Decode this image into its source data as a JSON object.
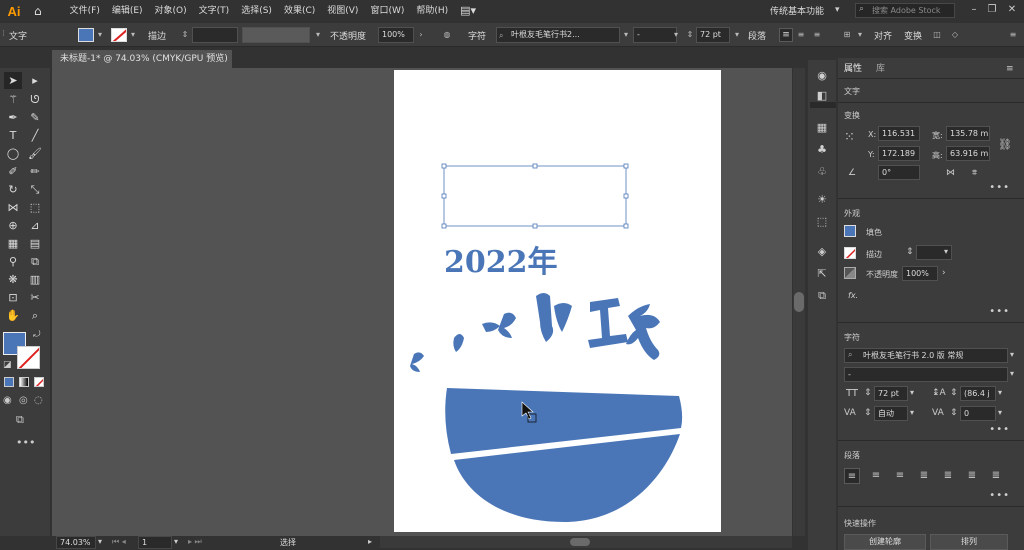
{
  "app": {
    "logo": "Ai"
  },
  "menu": [
    "文件(F)",
    "编辑(E)",
    "对象(O)",
    "文字(T)",
    "选择(S)",
    "效果(C)",
    "视图(V)",
    "窗口(W)",
    "帮助(H)"
  ],
  "workspace": "传统基本功能",
  "stock_search": {
    "placeholder": "搜索 Adobe Stock"
  },
  "control_bar": {
    "type_label": "文字",
    "stroke_label": "描边",
    "opacity_label": "不透明度",
    "opacity_value": "100%",
    "char_label": "字符",
    "font_value": "叶根友毛笔行书2...",
    "style_value": "-",
    "size_value": "72 pt",
    "para_label": "段落",
    "align_label": "对齐",
    "transform_label": "变换",
    "fill_color": "#4a76b8"
  },
  "document_tab": {
    "title": "未标题-1* @ 74.03% (CMYK/GPU 预览)",
    "close": "×"
  },
  "artwork": {
    "year_text": "2022年",
    "title_text": "美人迷鹿工号",
    "color": "#4a76b8"
  },
  "status_bar": {
    "zoom": "74.03%",
    "artboard": "1",
    "tool": "选择"
  },
  "properties_panel": {
    "tabs": [
      "属性",
      "库"
    ],
    "object_type": "文字",
    "transform": {
      "title": "变换",
      "x_label": "X:",
      "x": "116.531",
      "y_label": "Y:",
      "y": "172.189",
      "w_label": "宽:",
      "w": "135.78 m",
      "h_label": "高:",
      "h": "63.916 m",
      "angle": "0°"
    },
    "appearance": {
      "title": "外观",
      "fill_label": "填色",
      "stroke_label": "描边",
      "opacity_label": "不透明度",
      "opacity": "100%",
      "fx": "fx."
    },
    "character": {
      "title": "字符",
      "font": "叶根友毛笔行书 2.0 版 常规",
      "style": "-",
      "size": "72 pt",
      "leading": "(86.4 j",
      "tracking_auto": "自动",
      "kerning": "0"
    },
    "paragraph": {
      "title": "段落"
    },
    "quick_actions": {
      "title": "快速操作",
      "outline_button": "创建轮廓",
      "arrange_button": "排列"
    }
  }
}
